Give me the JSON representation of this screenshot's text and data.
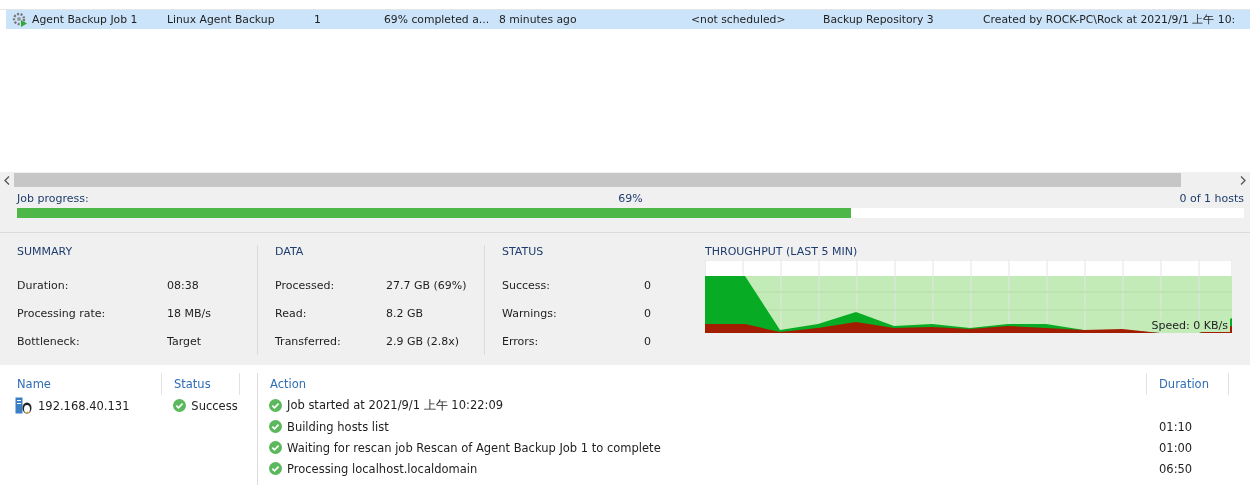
{
  "jobs": {
    "rows": [
      {
        "selected": true,
        "cells": [
          "Agent Backup Job 1",
          "Linux Agent Backup",
          "1",
          "69% completed a...",
          "8 minutes ago",
          "",
          "<not scheduled>",
          "Backup Repository 3",
          "Created by ROCK-PC\\Rock at 2021/9/1 上午 10:"
        ]
      }
    ]
  },
  "progress": {
    "label": "Job progress:",
    "percent": "69%",
    "hosts": "0 of 1 hosts",
    "level": 0.69
  },
  "summary": {
    "title": "SUMMARY",
    "items": [
      {
        "label": "Duration:",
        "value": "08:38"
      },
      {
        "label": "Processing rate:",
        "value": "18 MB/s"
      },
      {
        "label": "Bottleneck:",
        "value": "Target"
      }
    ]
  },
  "data": {
    "title": "DATA",
    "items": [
      {
        "label": "Processed:",
        "value": "27.7 GB (69%)"
      },
      {
        "label": "Read:",
        "value": "8.2 GB"
      },
      {
        "label": "Transferred:",
        "value": "2.9 GB (2.8x)"
      }
    ]
  },
  "status": {
    "title": "STATUS",
    "items": [
      {
        "label": "Success:",
        "value": "0"
      },
      {
        "label": "Warnings:",
        "value": "0"
      },
      {
        "label": "Errors:",
        "value": "0"
      }
    ]
  },
  "throughput": {
    "title": "THROUGHPUT (LAST 5 MIN)",
    "speed": "Speed: 0 KB/s"
  },
  "hosts": {
    "columns": [
      "Name",
      "Status"
    ],
    "rows": [
      {
        "name": "192.168.40.131",
        "status": "Success"
      }
    ]
  },
  "log": {
    "columns": [
      "Action",
      "Duration"
    ],
    "rows": [
      {
        "action": "Job started at 2021/9/1 上午 10:22:09",
        "duration": ""
      },
      {
        "action": "Building hosts list",
        "duration": "01:10"
      },
      {
        "action": "Waiting for rescan job Rescan of Agent Backup Job 1 to complete",
        "duration": "01:00"
      },
      {
        "action": "Processing localhost.localdomain",
        "duration": "06:50"
      }
    ]
  }
}
